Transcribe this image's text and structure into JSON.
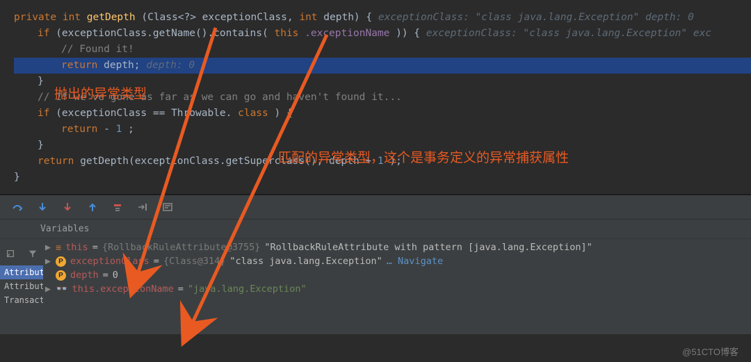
{
  "editor": {
    "method_sig": {
      "kw1": "private",
      "kw2": "int",
      "name": "getDepth",
      "p1": "(Class<?> exceptionClass,",
      "kw3": "int",
      "p2": " depth) {",
      "inlay": "exceptionClass: \"class java.lang.Exception\"  depth: 0"
    },
    "if1": {
      "kw": "if",
      "open": " (exceptionClass.getName().contains(",
      "kwthis": "this",
      "field": ".exceptionName",
      "close": ")) {",
      "inlay": "exceptionClass: \"class java.lang.Exception\"  exc"
    },
    "found_cmt": "// Found it!",
    "ret1": {
      "kw": "return",
      "var": " depth;",
      "inlay": "  depth: 0"
    },
    "close1": "}",
    "gone_cmt": "// If we've gone as far as we can go and haven't found it...",
    "if2": {
      "kw": "if",
      "open": " (exceptionClass == Throwable.",
      "kwcls": "class",
      "close": ") {"
    },
    "ret2": {
      "kw": "return",
      "val": " -",
      "num": "1",
      "semi": ";"
    },
    "close2": "}",
    "ret3": {
      "kw": "return",
      "call": " getDepth(exceptionClass.getSuperclass(), depth + ",
      "one": "1",
      "close": ");"
    },
    "close_method": "}"
  },
  "debug": {
    "vars_label": "Variables",
    "side_tabs": [
      "Attribute",
      "Attribute",
      "Transact"
    ],
    "rows": {
      "r1": {
        "name": "this",
        "eq": " = ",
        "cls": "{RollbackRuleAttribute@3755}",
        "val": " \"RollbackRuleAttribute with pattern [java.lang.Exception]\""
      },
      "r2": {
        "name": "exceptionClass",
        "eq": " = ",
        "cls": "{Class@314}",
        "val": " \"class java.lang.Exception\"",
        "nav": " … Navigate"
      },
      "r3": {
        "name": "depth",
        "eq": " = ",
        "val": "0"
      },
      "r4": {
        "name": "this.exceptionName",
        "eq": " = ",
        "val": "\"java.lang.Exception\""
      }
    }
  },
  "annotations": {
    "left": "抛出的异常类型",
    "right": "匹配的异常类型，这个是事务定义的异常捕获属性"
  },
  "watermark": "@51CTO博客"
}
